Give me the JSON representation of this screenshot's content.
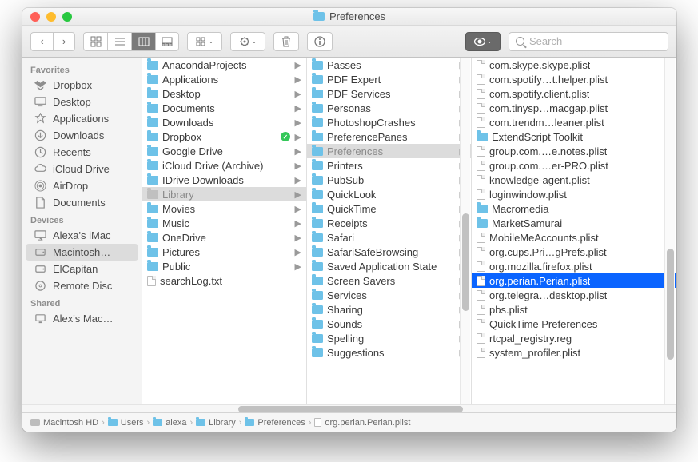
{
  "window": {
    "title": "Preferences"
  },
  "toolbar": {
    "search_placeholder": "Search"
  },
  "sidebar": {
    "sections": [
      {
        "header": "Favorites",
        "items": [
          {
            "label": "Dropbox",
            "icon": "dropbox"
          },
          {
            "label": "Desktop",
            "icon": "desktop"
          },
          {
            "label": "Applications",
            "icon": "apps"
          },
          {
            "label": "Downloads",
            "icon": "downloads"
          },
          {
            "label": "Recents",
            "icon": "recents"
          },
          {
            "label": "iCloud Drive",
            "icon": "icloud"
          },
          {
            "label": "AirDrop",
            "icon": "airdrop"
          },
          {
            "label": "Documents",
            "icon": "documents"
          }
        ]
      },
      {
        "header": "Devices",
        "items": [
          {
            "label": "Alexa's iMac",
            "icon": "imac"
          },
          {
            "label": "Macintosh…",
            "icon": "hdd",
            "selected": true
          },
          {
            "label": "ElCapitan",
            "icon": "hdd"
          },
          {
            "label": "Remote Disc",
            "icon": "disc"
          }
        ]
      },
      {
        "header": "Shared",
        "items": [
          {
            "label": "Alex's Mac…",
            "icon": "net"
          }
        ]
      }
    ]
  },
  "columns": [
    {
      "items": [
        {
          "label": "AnacondaProjects",
          "type": "folder",
          "arrow": true
        },
        {
          "label": "Applications",
          "type": "folder",
          "arrow": true
        },
        {
          "label": "Desktop",
          "type": "folder",
          "arrow": true
        },
        {
          "label": "Documents",
          "type": "folder",
          "arrow": true
        },
        {
          "label": "Downloads",
          "type": "folder",
          "arrow": true
        },
        {
          "label": "Dropbox",
          "type": "folder",
          "arrow": true,
          "badge": "sync"
        },
        {
          "label": "Google Drive",
          "type": "folder",
          "arrow": true
        },
        {
          "label": "iCloud Drive (Archive)",
          "type": "folder",
          "arrow": true
        },
        {
          "label": "IDrive Downloads",
          "type": "folder",
          "arrow": true
        },
        {
          "label": "Library",
          "type": "folder",
          "arrow": true,
          "selected": "gray",
          "dim": true
        },
        {
          "label": "Movies",
          "type": "folder",
          "arrow": true
        },
        {
          "label": "Music",
          "type": "folder",
          "arrow": true
        },
        {
          "label": "OneDrive",
          "type": "folder",
          "arrow": true
        },
        {
          "label": "Pictures",
          "type": "folder",
          "arrow": true
        },
        {
          "label": "Public",
          "type": "folder",
          "arrow": true
        },
        {
          "label": "searchLog.txt",
          "type": "doc"
        }
      ]
    },
    {
      "items": [
        {
          "label": "Passes",
          "type": "folder",
          "arrow": true
        },
        {
          "label": "PDF Expert",
          "type": "folder",
          "arrow": true
        },
        {
          "label": "PDF Services",
          "type": "folder",
          "arrow": true
        },
        {
          "label": "Personas",
          "type": "folder",
          "arrow": true
        },
        {
          "label": "PhotoshopCrashes",
          "type": "folder",
          "arrow": true
        },
        {
          "label": "PreferencePanes",
          "type": "folder",
          "arrow": true
        },
        {
          "label": "Preferences",
          "type": "folder",
          "arrow": true,
          "selected": "gray"
        },
        {
          "label": "Printers",
          "type": "folder",
          "arrow": true
        },
        {
          "label": "PubSub",
          "type": "folder",
          "arrow": true
        },
        {
          "label": "QuickLook",
          "type": "folder",
          "arrow": true
        },
        {
          "label": "QuickTime",
          "type": "folder",
          "arrow": true
        },
        {
          "label": "Receipts",
          "type": "folder",
          "arrow": true
        },
        {
          "label": "Safari",
          "type": "folder",
          "arrow": true
        },
        {
          "label": "SafariSafeBrowsing",
          "type": "folder",
          "arrow": true
        },
        {
          "label": "Saved Application State",
          "type": "folder",
          "arrow": true
        },
        {
          "label": "Screen Savers",
          "type": "folder",
          "arrow": true
        },
        {
          "label": "Services",
          "type": "folder",
          "arrow": true
        },
        {
          "label": "Sharing",
          "type": "folder",
          "arrow": true
        },
        {
          "label": "Sounds",
          "type": "folder",
          "arrow": true
        },
        {
          "label": "Spelling",
          "type": "folder",
          "arrow": true
        },
        {
          "label": "Suggestions",
          "type": "folder",
          "arrow": true
        }
      ],
      "scroll": {
        "pos": 0.45,
        "size": 0.28
      }
    },
    {
      "items": [
        {
          "label": "com.skype.skype.plist",
          "type": "doc"
        },
        {
          "label": "com.spotify…t.helper.plist",
          "type": "doc"
        },
        {
          "label": "com.spotify.client.plist",
          "type": "doc"
        },
        {
          "label": "com.tinysp…macgap.plist",
          "type": "doc"
        },
        {
          "label": "com.trendm…leaner.plist",
          "type": "doc"
        },
        {
          "label": "ExtendScript Toolkit",
          "type": "folder",
          "arrow": true
        },
        {
          "label": "group.com.…e.notes.plist",
          "type": "doc"
        },
        {
          "label": "group.com.…er-PRO.plist",
          "type": "doc"
        },
        {
          "label": "knowledge-agent.plist",
          "type": "doc"
        },
        {
          "label": "loginwindow.plist",
          "type": "doc"
        },
        {
          "label": "Macromedia",
          "type": "folder",
          "arrow": true
        },
        {
          "label": "MarketSamurai",
          "type": "folder",
          "arrow": true
        },
        {
          "label": "MobileMeAccounts.plist",
          "type": "doc"
        },
        {
          "label": "org.cups.Pri…gPrefs.plist",
          "type": "doc"
        },
        {
          "label": "org.mozilla.firefox.plist",
          "type": "doc"
        },
        {
          "label": "org.perian.Perian.plist",
          "type": "doc",
          "selected": "blue"
        },
        {
          "label": "org.telegra…desktop.plist",
          "type": "doc"
        },
        {
          "label": "pbs.plist",
          "type": "doc"
        },
        {
          "label": "QuickTime Preferences",
          "type": "doc"
        },
        {
          "label": "rtcpal_registry.reg",
          "type": "doc"
        },
        {
          "label": "system_profiler.plist",
          "type": "doc"
        }
      ],
      "scroll": {
        "pos": 0.55,
        "size": 0.32
      }
    }
  ],
  "pathbar": [
    {
      "label": "Macintosh HD",
      "icon": "hdd"
    },
    {
      "label": "Users",
      "icon": "folder"
    },
    {
      "label": "alexa",
      "icon": "folder"
    },
    {
      "label": "Library",
      "icon": "folder"
    },
    {
      "label": "Preferences",
      "icon": "folder"
    },
    {
      "label": "org.perian.Perian.plist",
      "icon": "doc"
    }
  ],
  "hscroll": {
    "pos": 0.18,
    "size": 0.42
  }
}
